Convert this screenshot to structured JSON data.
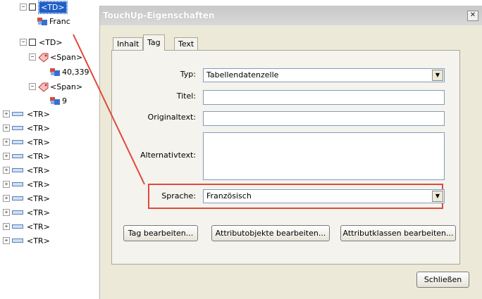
{
  "tree": {
    "items": [
      {
        "expander": "−",
        "label": "<TD>"
      },
      {
        "label": "Franc"
      },
      {
        "expander": "−",
        "label": "<TD>"
      },
      {
        "expander": "−",
        "label": "<Span>"
      },
      {
        "label": "40,339"
      },
      {
        "expander": "−",
        "label": "<Span>"
      },
      {
        "label": "9"
      },
      {
        "expander": "+",
        "label": "<TR>"
      },
      {
        "expander": "+",
        "label": "<TR>"
      },
      {
        "expander": "+",
        "label": "<TR>"
      },
      {
        "expander": "+",
        "label": "<TR>"
      },
      {
        "expander": "+",
        "label": "<TR>"
      },
      {
        "expander": "+",
        "label": "<TR>"
      },
      {
        "expander": "+",
        "label": "<TR>"
      },
      {
        "expander": "+",
        "label": "<TR>"
      },
      {
        "expander": "+",
        "label": "<TR>"
      },
      {
        "expander": "+",
        "label": "<TR>"
      }
    ]
  },
  "dialog": {
    "title": "TouchUp-Eigenschaften",
    "close_glyph": "✕",
    "tabs": [
      "Inhalt",
      "Tag",
      "Text"
    ],
    "active_tab": "Tag",
    "fields": {
      "typ_label": "Typ:",
      "typ_value": "Tabellendatenzelle",
      "titel_label": "Titel:",
      "titel_value": "",
      "original_label": "Originaltext:",
      "original_value": "",
      "alternativ_label": "Alternativtext:",
      "alternativ_value": "",
      "sprache_label": "Sprache:",
      "sprache_value": "Französisch"
    },
    "buttons": {
      "tag_edit": "Tag bearbeiten...",
      "attr_objects": "Attributobjekte bearbeiten...",
      "attr_classes": "Attributklassen bearbeiten...",
      "close": "Schließen"
    },
    "dropdown_arrow": "▼"
  },
  "colors": {
    "selection": "#1f5fc8",
    "highlight": "#e0493a",
    "dialog_bg": "#ece9d8"
  }
}
